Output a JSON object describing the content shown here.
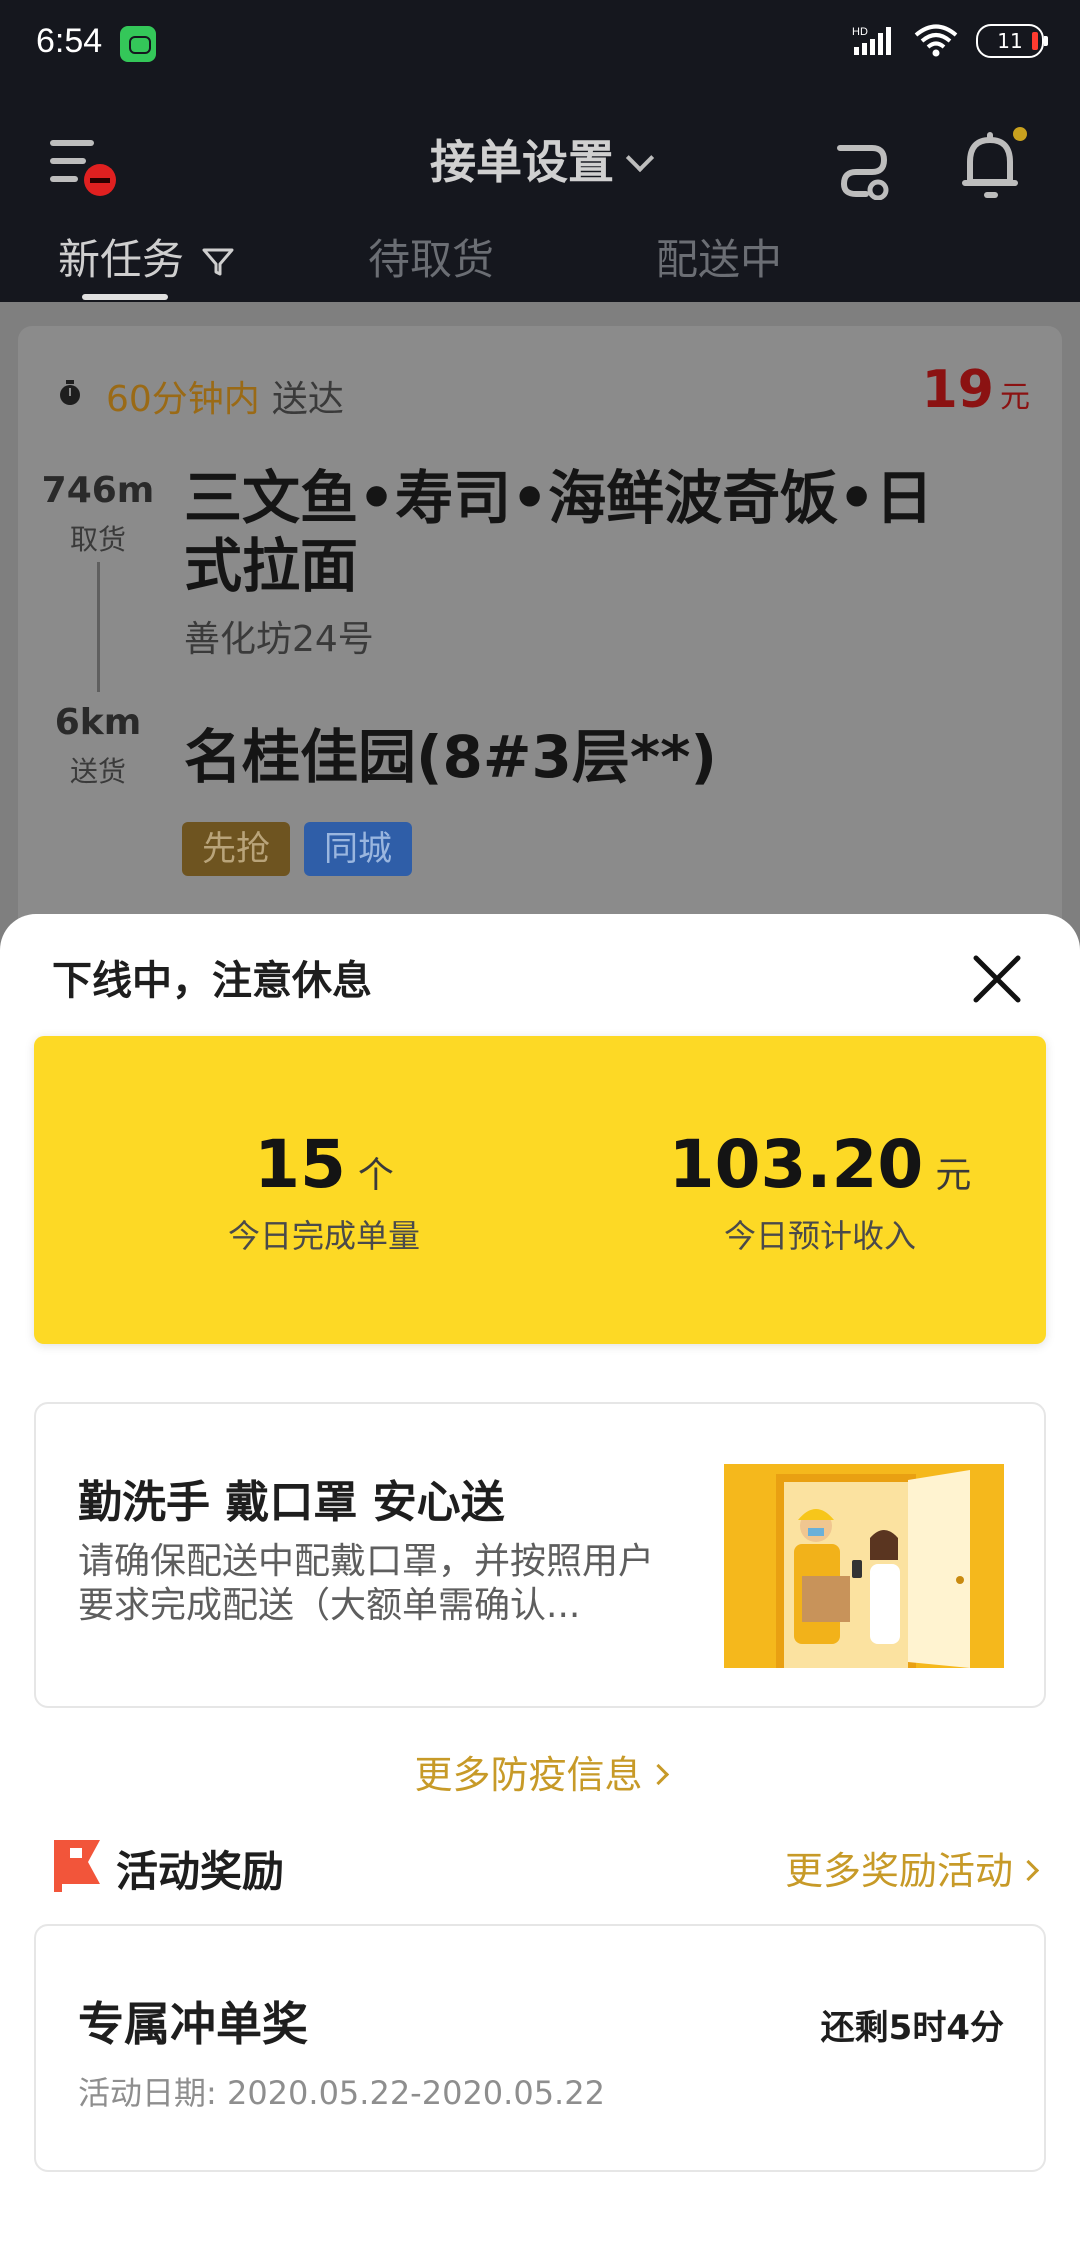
{
  "status_bar": {
    "time": "6:54",
    "battery": "11",
    "network_label": "HD"
  },
  "header": {
    "title": "接单设置"
  },
  "tabs": [
    {
      "label": "新任务"
    },
    {
      "label": "待取货"
    },
    {
      "label": "配送中"
    }
  ],
  "order": {
    "time_highlight": "60分钟内",
    "time_suffix": "送达",
    "price": "19",
    "price_unit": "元",
    "pickup_distance": "746m",
    "pickup_label": "取货",
    "delivery_distance": "6km",
    "delivery_label": "送货",
    "shop_name": "三文鱼•寿司•海鲜波奇饭•日式拉面",
    "shop_address": "善化坊24号",
    "destination": "名桂佳园(8#3层**)",
    "tags": [
      "先抢",
      "同城"
    ]
  },
  "sheet": {
    "title": "下线中，注意休息",
    "stats": {
      "orders_value": "15",
      "orders_unit": "个",
      "orders_label": "今日完成单量",
      "income_value": "103.20",
      "income_unit": "元",
      "income_label": "今日预计收入"
    },
    "notice": {
      "title": "勤洗手 戴口罩 安心送",
      "text": "请确保配送中配戴口罩，并按照用户要求完成配送（大额单需确认..."
    },
    "more_epidemic": "更多防疫信息",
    "activity": {
      "title": "活动奖励",
      "more": "更多奖励活动",
      "reward_title": "专属冲单奖",
      "remaining": "还剩5时4分",
      "date": "活动日期: 2020.05.22-2020.05.22"
    }
  },
  "colors": {
    "accent_yellow": "#fdd925",
    "gold_text": "#c79a28",
    "price_red": "#c01818"
  }
}
